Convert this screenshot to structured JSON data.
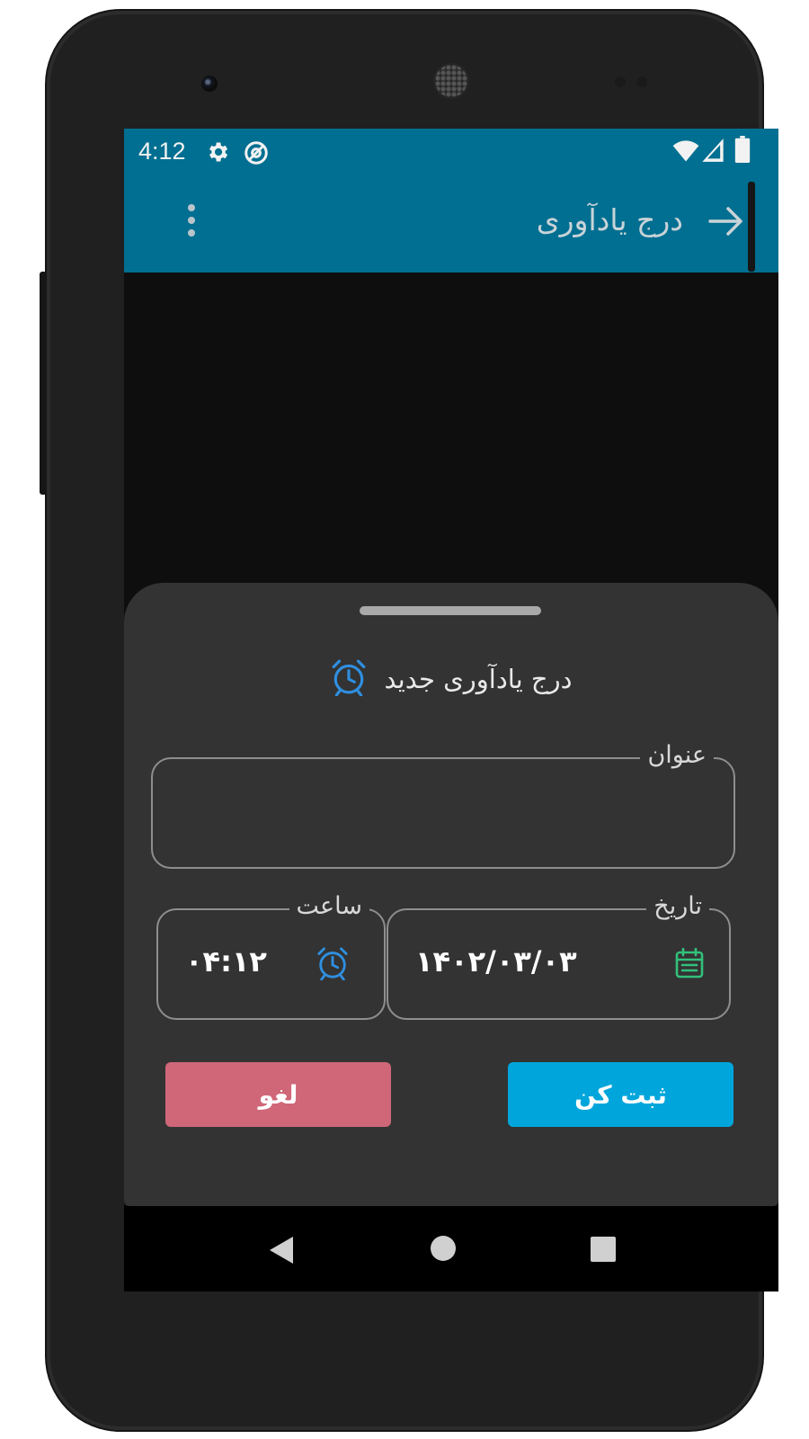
{
  "status_bar": {
    "time": "4:12",
    "icons": [
      "gear-icon",
      "at-sign-icon",
      "wifi-icon",
      "signal-icon",
      "battery-icon"
    ]
  },
  "app_bar": {
    "title": "درج یادآوری",
    "back_icon": "arrow-right-icon",
    "menu_icon": "more-vert-icon"
  },
  "sheet": {
    "title": "درج یادآوری جدید",
    "title_icon": "alarm-clock-icon",
    "title_field": {
      "label": "عنوان",
      "value": ""
    },
    "date_field": {
      "label": "تاریخ",
      "value": "۱۴۰۲/۰۳/۰۳",
      "icon": "calendar-icon"
    },
    "time_field": {
      "label": "ساعت",
      "value": "۰۴:۱۲",
      "icon": "alarm-clock-icon"
    },
    "submit_label": "ثبت کن",
    "cancel_label": "لغو"
  },
  "nav_bar": {
    "icons": [
      "back-triangle-icon",
      "home-circle-icon",
      "recents-square-icon"
    ]
  },
  "colors": {
    "app_bar": "#006f91",
    "sheet": "#333333",
    "submit": "#00a6db",
    "cancel": "#cf6779",
    "accent_blue": "#2f8fe0",
    "accent_green": "#33c07a"
  }
}
